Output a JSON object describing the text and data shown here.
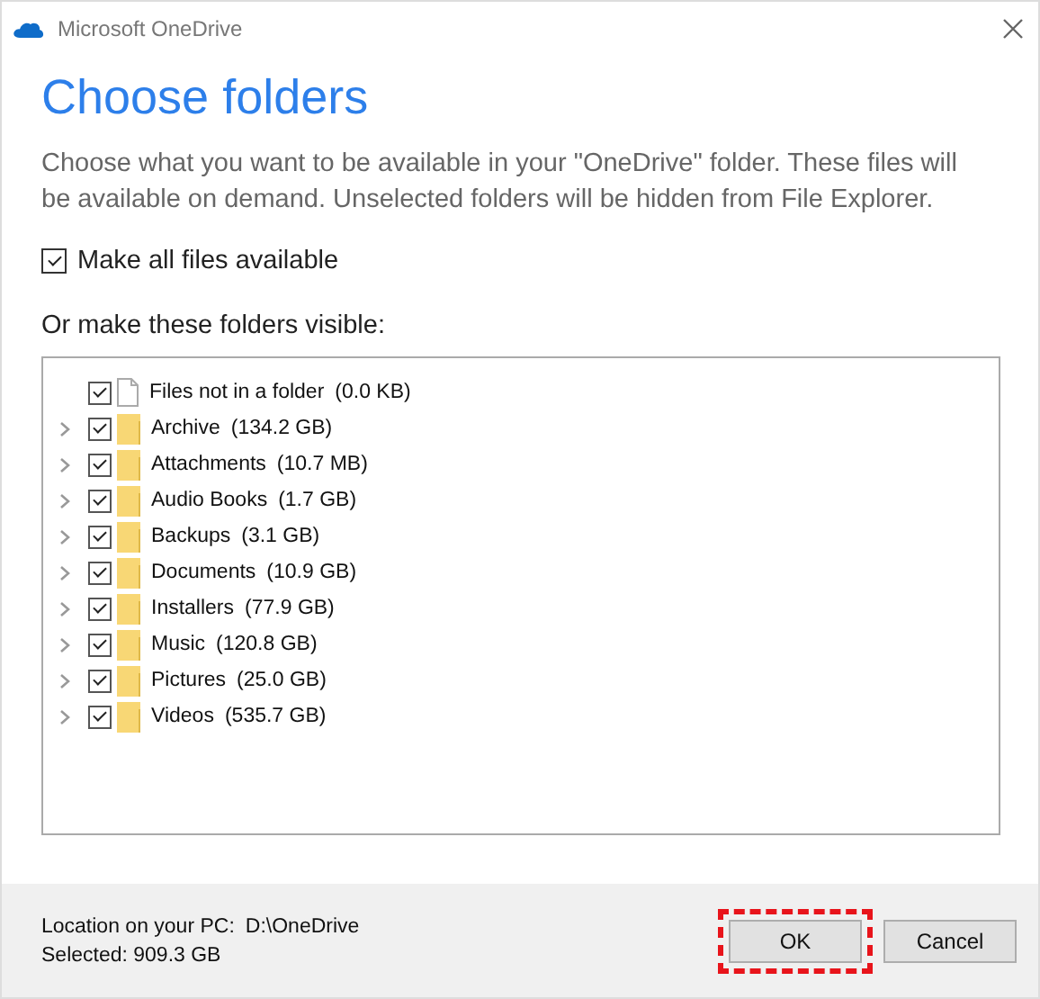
{
  "window": {
    "title": "Microsoft OneDrive"
  },
  "heading": "Choose folders",
  "description": "Choose what you want to be available in your \"OneDrive\" folder. These files will be available on demand. Unselected folders will be hidden from File Explorer.",
  "make_all": {
    "label": "Make all files available",
    "checked": true
  },
  "folders_label": "Or make these folders visible:",
  "items": [
    {
      "kind": "file",
      "name": "Files not in a folder",
      "size": "(0.0 KB)",
      "checked": true
    },
    {
      "kind": "folder",
      "name": "Archive",
      "size": "(134.2 GB)",
      "checked": true
    },
    {
      "kind": "folder",
      "name": "Attachments",
      "size": "(10.7 MB)",
      "checked": true
    },
    {
      "kind": "folder",
      "name": "Audio Books",
      "size": "(1.7 GB)",
      "checked": true
    },
    {
      "kind": "folder",
      "name": "Backups",
      "size": "(3.1 GB)",
      "checked": true
    },
    {
      "kind": "folder",
      "name": "Documents",
      "size": "(10.9 GB)",
      "checked": true
    },
    {
      "kind": "folder",
      "name": "Installers",
      "size": "(77.9 GB)",
      "checked": true
    },
    {
      "kind": "folder",
      "name": "Music",
      "size": "(120.8 GB)",
      "checked": true
    },
    {
      "kind": "folder",
      "name": "Pictures",
      "size": "(25.0 GB)",
      "checked": true
    },
    {
      "kind": "folder",
      "name": "Videos",
      "size": "(535.7 GB)",
      "checked": true
    }
  ],
  "footer": {
    "location_label": "Location on your PC:",
    "location": "D:\\OneDrive",
    "selected": "Selected: 909.3 GB"
  },
  "buttons": [
    {
      "label": "OK",
      "highlighted": true
    },
    {
      "label": "Cancel",
      "highlighted": false
    }
  ]
}
